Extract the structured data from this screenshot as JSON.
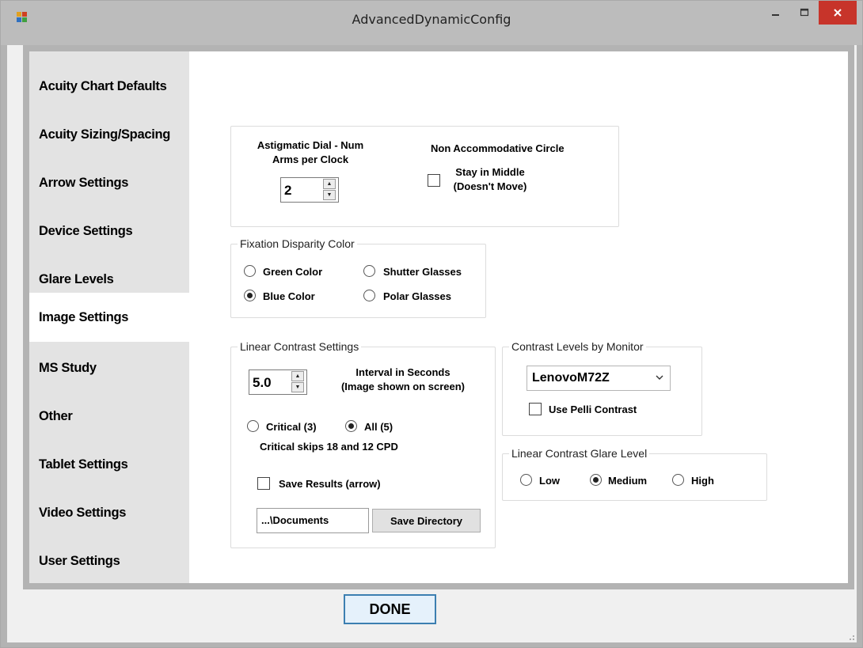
{
  "window": {
    "title": "AdvancedDynamicConfig",
    "minimize_icon": "minimize-icon",
    "maximize_icon": "maximize-icon",
    "close_icon": "close-icon",
    "close_color": "#c7342a"
  },
  "tabs": [
    {
      "label": "Acuity Chart Defaults",
      "active": false
    },
    {
      "label": "Acuity Sizing/Spacing",
      "active": false
    },
    {
      "label": "Arrow Settings",
      "active": false
    },
    {
      "label": "Device Settings",
      "active": false
    },
    {
      "label": "Glare Levels",
      "active": false
    },
    {
      "label": "Image Settings",
      "active": true
    },
    {
      "label": "MS Study",
      "active": false
    },
    {
      "label": "Other",
      "active": false
    },
    {
      "label": "Tablet Settings",
      "active": false
    },
    {
      "label": "Video Settings",
      "active": false
    },
    {
      "label": "User Settings",
      "active": false
    }
  ],
  "astig": {
    "label_line1": "Astigmatic Dial - Num",
    "label_line2": "Arms per Clock",
    "value": "2",
    "non_accom_title": "Non Accommodative Circle",
    "stay_line1": "Stay in Middle",
    "stay_line2": "(Doesn't Move)",
    "stay_checked": false
  },
  "fixation": {
    "title": "Fixation Disparity Color",
    "options": [
      {
        "label": "Green Color",
        "selected": false
      },
      {
        "label": "Shutter Glasses",
        "selected": false
      },
      {
        "label": "Blue Color",
        "selected": true
      },
      {
        "label": "Polar Glasses",
        "selected": false
      }
    ]
  },
  "linear": {
    "title": "Linear Contrast Settings",
    "interval_value": "5.0",
    "interval_line1": "Interval in Seconds",
    "interval_line2": "(Image shown on screen)",
    "critical_label": "Critical (3)",
    "critical_selected": false,
    "all_label": "All (5)",
    "all_selected": true,
    "note": "Critical skips 18 and 12 CPD",
    "save_results_label": "Save Results (arrow)",
    "save_results_checked": false,
    "directory_value": "...\\Documents",
    "save_directory_button": "Save Directory"
  },
  "monitor": {
    "title": "Contrast Levels by Monitor",
    "selected": "LenovoM72Z",
    "pelli_label": "Use Pelli Contrast",
    "pelli_checked": false
  },
  "glare": {
    "title": "Linear Contrast Glare Level",
    "options": [
      {
        "label": "Low",
        "selected": false
      },
      {
        "label": "Medium",
        "selected": true
      },
      {
        "label": "High",
        "selected": false
      }
    ]
  },
  "done_label": "DONE"
}
